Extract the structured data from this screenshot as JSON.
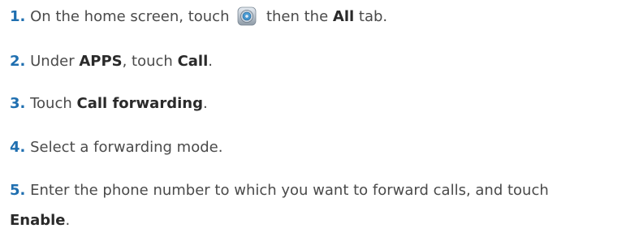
{
  "steps": [
    {
      "number": "1.",
      "pre": "On the home screen, touch",
      "icon": "settings-icon",
      "mid": "then the",
      "bold": "All",
      "post": "tab."
    },
    {
      "number": "2.",
      "pre": "Under",
      "bold1": "APPS",
      "mid": ", touch",
      "bold2": "Call",
      "post": "."
    },
    {
      "number": "3.",
      "pre": "Touch",
      "bold": "Call forwarding",
      "post": "."
    },
    {
      "number": "4.",
      "text": "Select a forwarding mode."
    },
    {
      "number": "5.",
      "text": "Enter the phone number to which you want to forward calls, and touch",
      "bold": "Enable",
      "post": "."
    }
  ],
  "colors": {
    "number": "#1f6fb0",
    "text": "#4a4a4a",
    "bold": "#2a2a2a"
  }
}
